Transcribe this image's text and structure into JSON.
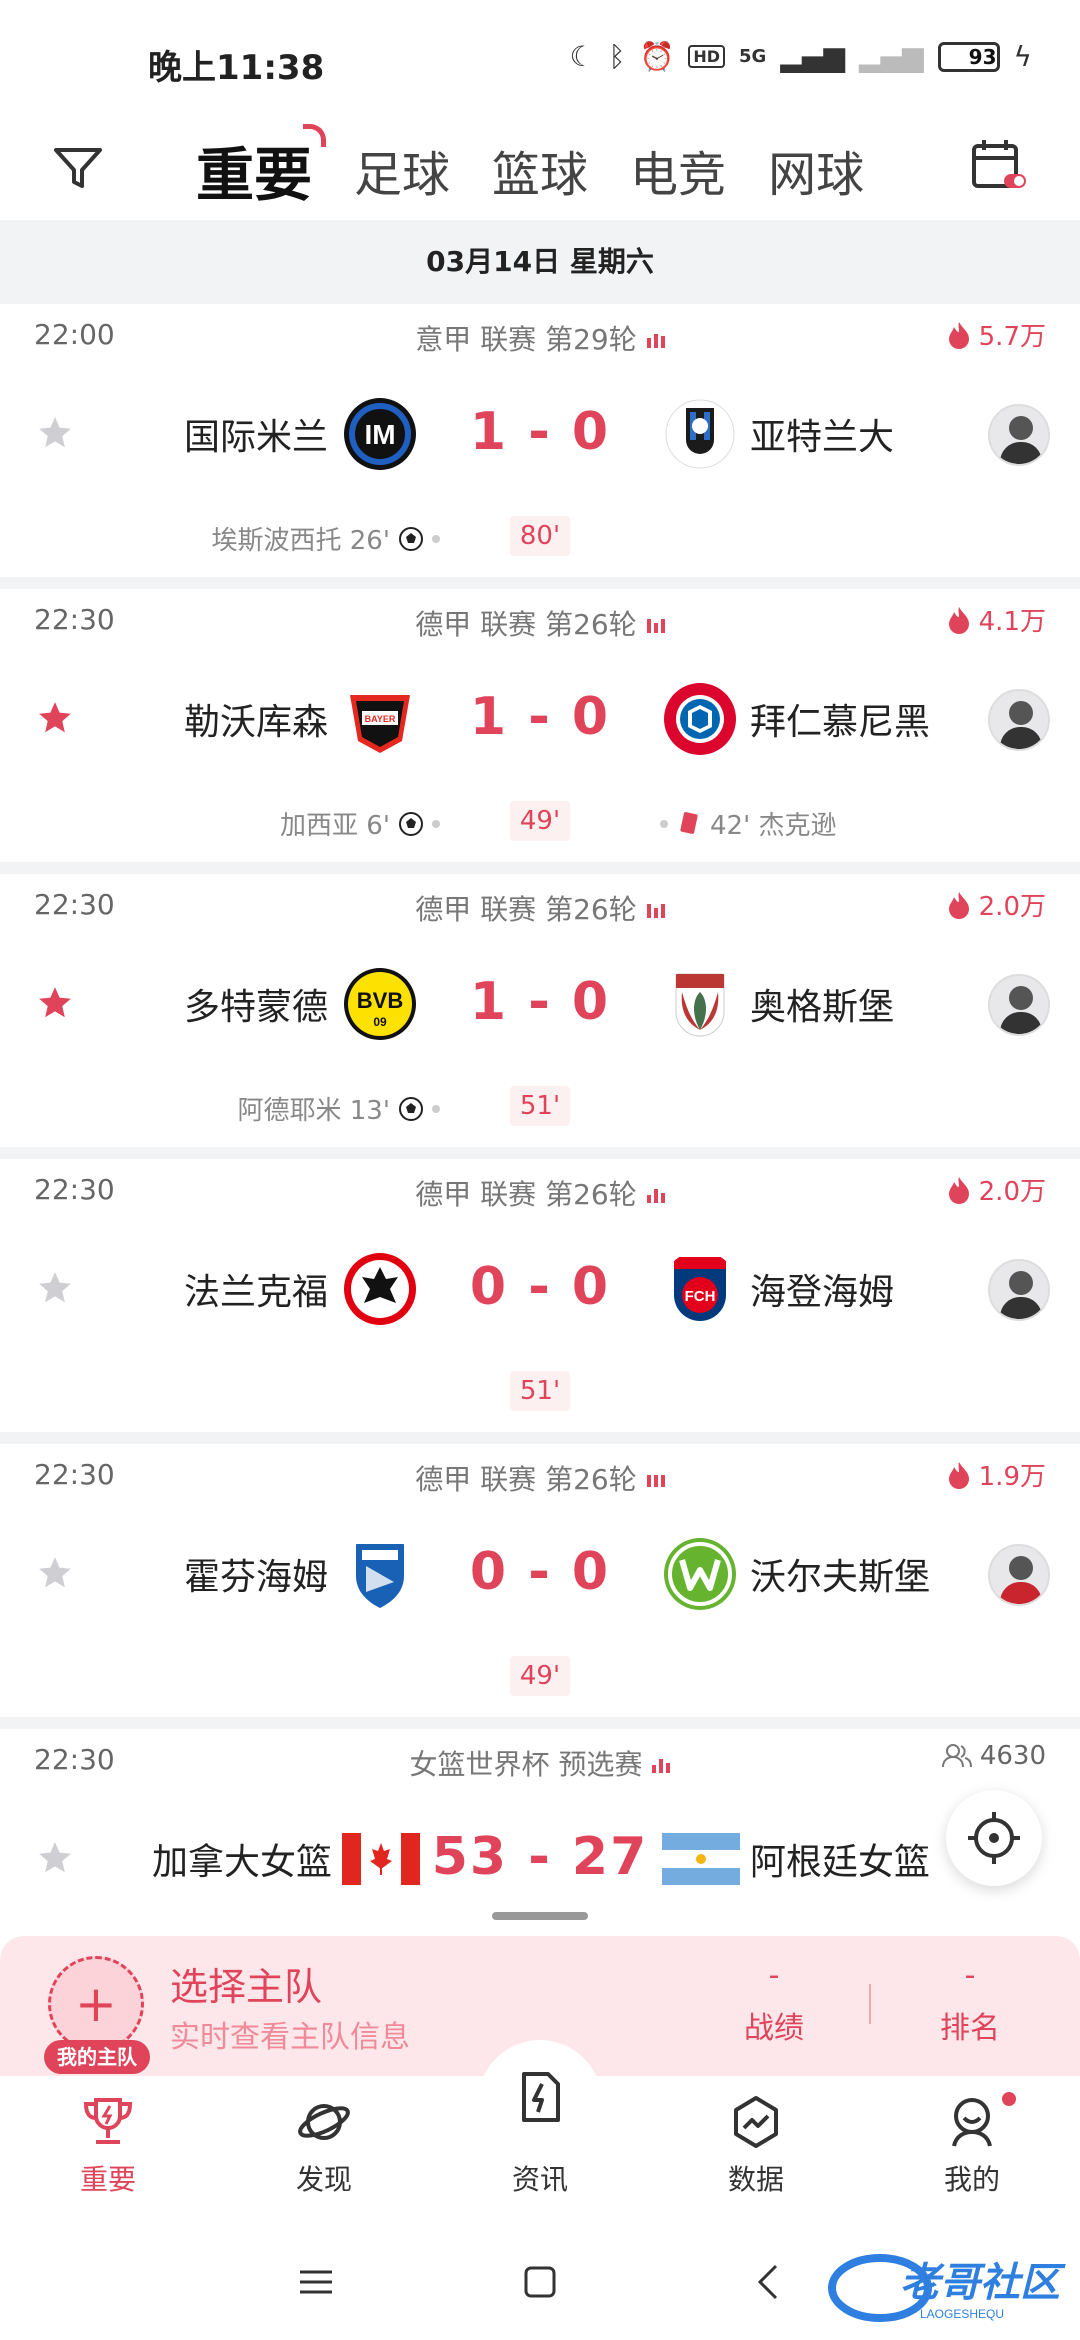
{
  "status_bar": {
    "time": "晚上11:38",
    "network": "5G",
    "battery": "93",
    "battery_level": 0.93,
    "hd": "HD"
  },
  "top_nav": {
    "tabs": [
      {
        "label": "重要",
        "active": true
      },
      {
        "label": "足球",
        "active": false
      },
      {
        "label": "篮球",
        "active": false
      },
      {
        "label": "电竞",
        "active": false
      },
      {
        "label": "网球",
        "active": false
      }
    ]
  },
  "date_bar": {
    "label": "03月14日  星期六"
  },
  "matches": [
    {
      "time": "22:00",
      "league": "意甲 联赛 第29轮",
      "heat": "5.7万",
      "starred": false,
      "home": "国际米兰",
      "away": "亚特兰大",
      "score": "1 - 0",
      "minute": "80'",
      "home_event": "埃斯波西托  26'",
      "away_event": ""
    },
    {
      "time": "22:30",
      "league": "德甲 联赛 第26轮",
      "heat": "4.1万",
      "starred": true,
      "home": "勒沃库森",
      "away": "拜仁慕尼黑",
      "score": "1 - 0",
      "minute": "49'",
      "home_event": "加西亚  6'",
      "away_event": "42'  杰克逊"
    },
    {
      "time": "22:30",
      "league": "德甲 联赛 第26轮",
      "heat": "2.0万",
      "starred": true,
      "home": "多特蒙德",
      "away": "奥格斯堡",
      "score": "1 - 0",
      "minute": "51'",
      "home_event": "阿德耶米  13'",
      "away_event": ""
    },
    {
      "time": "22:30",
      "league": "德甲 联赛 第26轮",
      "heat": "2.0万",
      "starred": false,
      "home": "法兰克福",
      "away": "海登海姆",
      "score": "0 - 0",
      "minute": "51'",
      "home_event": "",
      "away_event": ""
    },
    {
      "time": "22:30",
      "league": "德甲 联赛 第26轮",
      "heat": "1.9万",
      "starred": false,
      "home": "霍芬海姆",
      "away": "沃尔夫斯堡",
      "score": "0 - 0",
      "minute": "49'",
      "home_event": "",
      "away_event": ""
    },
    {
      "time": "22:30",
      "league": "女篮世界杯 预选赛",
      "viewers": "4630",
      "starred": false,
      "home": "加拿大女篮",
      "away": "阿根廷女篮",
      "score": "53 - 27"
    }
  ],
  "team_panel": {
    "badge": "我的主队",
    "title": "选择主队",
    "subtitle": "实时查看主队信息",
    "stats": [
      {
        "value": "-",
        "label": "战绩"
      },
      {
        "value": "-",
        "label": "排名"
      }
    ]
  },
  "bottom_nav": [
    {
      "label": "重要",
      "icon": "trophy-icon",
      "active": true
    },
    {
      "label": "发现",
      "icon": "planet-icon",
      "active": false
    },
    {
      "label": "资讯",
      "icon": "news-icon",
      "active": false
    },
    {
      "label": "数据",
      "icon": "data-icon",
      "active": false
    },
    {
      "label": "我的",
      "icon": "profile-icon",
      "active": false
    }
  ],
  "colors": {
    "accent": "#e0445a",
    "background_gray": "#f2f3f5",
    "panel_pink": "#fde7ea"
  }
}
